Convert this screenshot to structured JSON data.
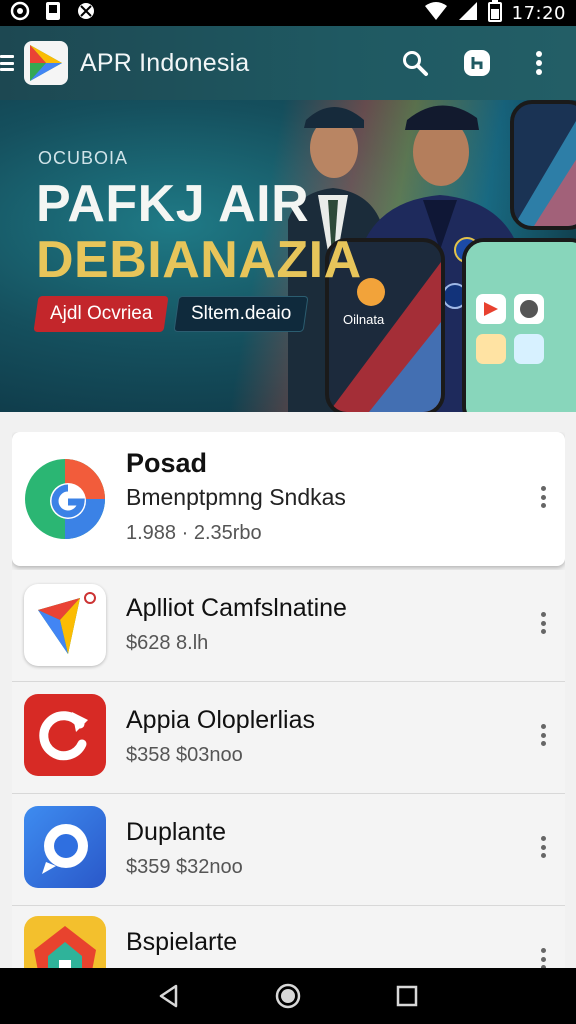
{
  "status_bar": {
    "time": "17:20",
    "icons": [
      "record-icon",
      "sim-icon",
      "settings-icon",
      "wifi-icon",
      "signal-icon",
      "battery-icon"
    ]
  },
  "toolbar": {
    "title": "APR Indonesia",
    "actions": [
      "search-icon",
      "account-icon",
      "overflow-icon"
    ]
  },
  "banner": {
    "kicker": "OCUBOIA",
    "title_line1": "PAFKJ AIR",
    "title_line2": "DEBIANAZIA",
    "button_red": "Ajdl Ocvriea",
    "button_dark": "Sltem.deaio",
    "phone_label": "Oilnata",
    "colors": {
      "accent_gold": "#e7c55a",
      "button_red": "#c3262b",
      "panel_teal": "#15505e"
    }
  },
  "apps": [
    {
      "name": "Posad",
      "subtitle": "Bmenptpmng Sndkas",
      "price": "1.988 · 2.35rbo",
      "icon": "g-swirl-icon",
      "featured": true
    },
    {
      "name": "Aplliot Camfslnatine",
      "subtitle": "",
      "price": "$628  8.lh",
      "icon": "play-triangle-icon",
      "featured": false
    },
    {
      "name": "Appia Oloplerlias",
      "subtitle": "",
      "price": "$358  $03noo",
      "icon": "red-refresh-icon",
      "featured": false
    },
    {
      "name": "Duplante",
      "subtitle": "",
      "price": "$359  $32noo",
      "icon": "blue-chat-icon",
      "featured": false
    },
    {
      "name": "Bspielarte",
      "subtitle": "",
      "price": "",
      "icon": "home-shield-icon",
      "featured": false
    }
  ],
  "navbar": {
    "buttons": [
      "back-icon",
      "home-icon",
      "recents-icon"
    ]
  }
}
